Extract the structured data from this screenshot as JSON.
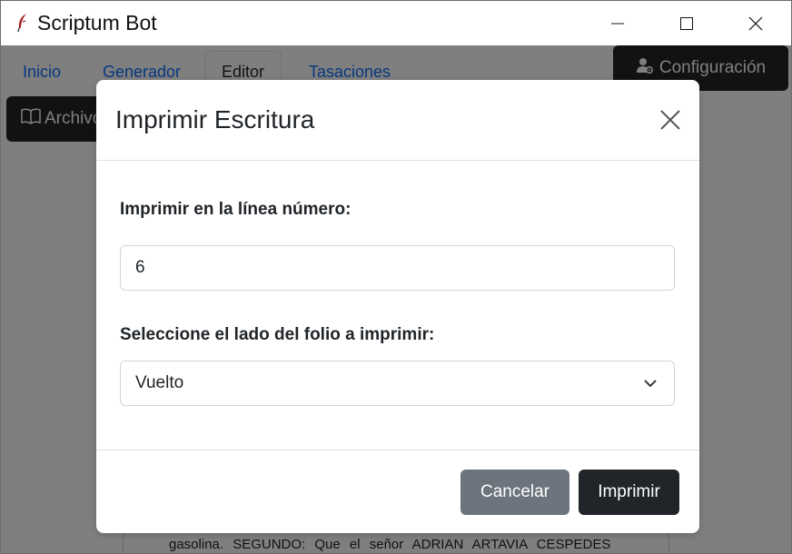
{
  "window": {
    "title": "Scriptum Bot",
    "icon": "quill-icon"
  },
  "nav": {
    "tabs": [
      {
        "label": "Inicio"
      },
      {
        "label": "Generador"
      },
      {
        "label": "Editor"
      },
      {
        "label": "Tasaciones"
      }
    ],
    "active_tab": "Editor",
    "config_label": "Configuración",
    "archivo_label": "Archivo"
  },
  "document": {
    "visible_text": "gasolina. SEGUNDO: Que el señor ADRIAN ARTAVIA CESPEDES"
  },
  "modal": {
    "title": "Imprimir Escritura",
    "line_label": "Imprimir en la línea número:",
    "line_value": "6",
    "side_label": "Seleccione el lado del folio a imprimir:",
    "side_value": "Vuelto",
    "cancel_label": "Cancelar",
    "print_label": "Imprimir"
  },
  "colors": {
    "link": "#0d6efd",
    "dark_button": "#212529",
    "secondary_button": "#6c757d",
    "app_icon": "#a3221f"
  }
}
